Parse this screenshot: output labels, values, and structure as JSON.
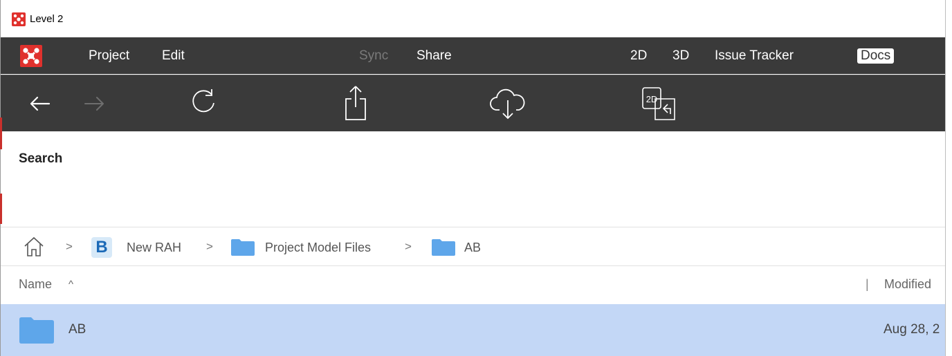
{
  "window": {
    "title": "Level 2"
  },
  "menubar": {
    "items": [
      {
        "label": "Project",
        "enabled": true
      },
      {
        "label": "Edit",
        "enabled": true
      },
      {
        "label": "Sync",
        "enabled": false
      },
      {
        "label": "Share",
        "enabled": true
      },
      {
        "label": "2D",
        "enabled": true
      },
      {
        "label": "3D",
        "enabled": true
      },
      {
        "label": "Issue Tracker",
        "enabled": true
      },
      {
        "label": "Docs",
        "enabled": true,
        "selected": true
      }
    ]
  },
  "toolbar": {
    "icons": [
      "back-arrow-icon",
      "forward-arrow-icon",
      "refresh-icon",
      "upload-share-icon",
      "cloud-download-icon",
      "2d-sheet-icon"
    ],
    "sheet_icon_text": "2D"
  },
  "search": {
    "label": "Search"
  },
  "breadcrumb": {
    "items": [
      "New RAH",
      "Project Model Files",
      "AB"
    ],
    "badge_letter": "B",
    "separator": ">"
  },
  "list": {
    "columns": {
      "name": "Name",
      "sort_indicator": "^",
      "modified": "Modified",
      "column_sep": "|"
    },
    "rows": [
      {
        "name": "AB",
        "modified": "Aug 28, 2"
      }
    ]
  },
  "colors": {
    "menubar_bg": "#3a3a3a",
    "brand_red": "#e0312d",
    "selected_row": "#c3d7f6",
    "folder_blue": "#5ea6ea"
  }
}
